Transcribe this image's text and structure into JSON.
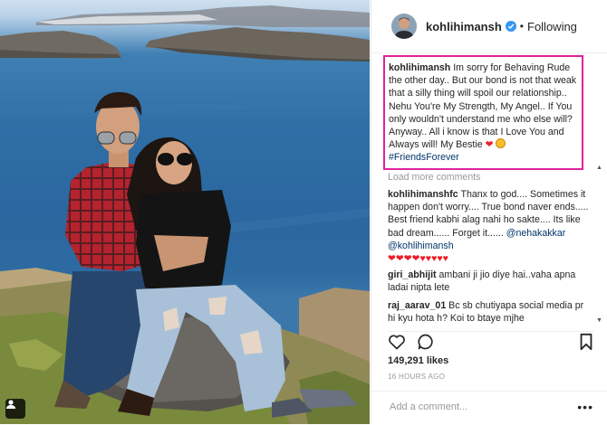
{
  "post": {
    "username": "kohlihimansh",
    "separator": "•",
    "follow_status": "Following"
  },
  "caption": {
    "username": "kohlihimansh",
    "text": "Im sorry for Behaving Rude the other day.. But our bond is not that weak that a silly thing will spoil our relationship.. Nehu You're My Strength, My Angel.. If You only wouldn't understand me who else will? Anyway.. All i know is that I Love You and Always will! My Bestie",
    "heart": "❤",
    "hashtag": "#FriendsForever"
  },
  "load_more": "Load more comments",
  "comments": [
    {
      "username": "kohlihimanshfc",
      "text": "Thanx to god.... Sometimes it happen don't worry.... True bond naver ends..... Best friend kabhi alag nahi ho sakte.... Its like bad dream...... Forget it......",
      "mentions": [
        "@nehakakkar",
        "@kohlihimansh"
      ],
      "hearts": "❤❤❤❤♥♥♥♥♥"
    },
    {
      "username": "giri_abhijit",
      "text": "ambani ji jio diye hai..vaha apna ladai nipta lete"
    },
    {
      "username": "raj_aarav_01",
      "text": "Bc sb chutiyapa social media pr hi kyu hota h? Koi to btaye mjhe"
    }
  ],
  "likes": "149,291 likes",
  "timestamp": "16 HOURS AGO",
  "add_comment_placeholder": "Add a comment...",
  "more_options": "•••",
  "icons": {
    "verified": "verified-badge-icon",
    "like": "heart-icon",
    "comment": "comment-bubble-icon",
    "save": "bookmark-icon",
    "user_tag": "user-tag-icon"
  },
  "colors": {
    "highlight_border": "#e0229c",
    "verified": "#3897f0",
    "mention": "#003569",
    "muted": "#999999"
  }
}
